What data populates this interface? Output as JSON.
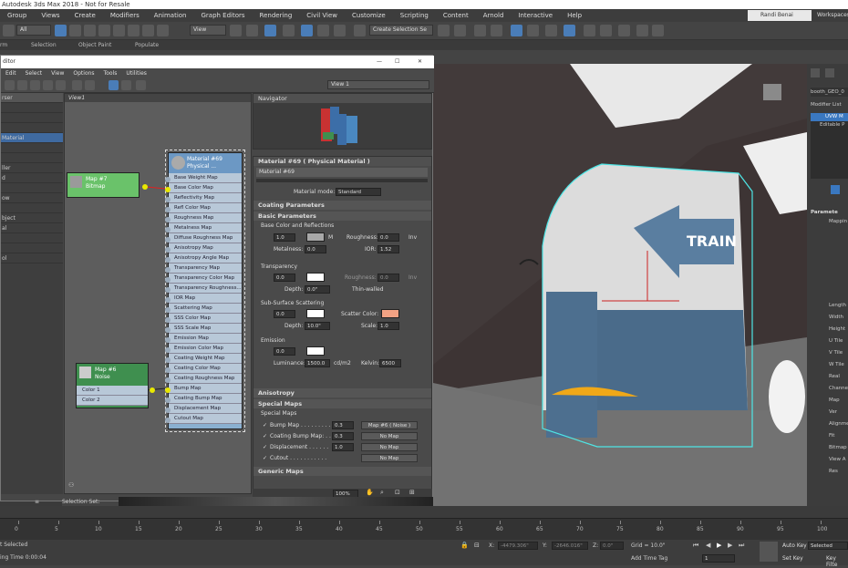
{
  "app": {
    "title": "Autodesk 3ds Max 2018 - Not for Resale"
  },
  "menu": [
    "Group",
    "Views",
    "Create",
    "Modifiers",
    "Animation",
    "Graph Editors",
    "Rendering",
    "Civil View",
    "Customize",
    "Scripting",
    "Content",
    "Arnold",
    "Interactive",
    "Help"
  ],
  "user": {
    "name": "Randi Benai",
    "workspaces_label": "Workspaces"
  },
  "toolbar": {
    "filter_value": "All",
    "view_value": "View",
    "selection_set_placeholder": "Create Selection Se"
  },
  "ribbon": {
    "items": [
      "rm",
      "Selection",
      "Object Paint",
      "Populate"
    ]
  },
  "sme": {
    "title": "ditor",
    "menu": [
      "Edit",
      "Select",
      "View",
      "Options",
      "Tools",
      "Utilities"
    ],
    "view_dropdown": "View 1",
    "browser_header": "rser",
    "browser_items": [
      "",
      "",
      "",
      "Material",
      "",
      "",
      "ller",
      "d",
      "",
      "ow",
      "",
      "bject",
      "al",
      "",
      "",
      "ol"
    ],
    "view_tab": "View1",
    "nodes": {
      "bitmap": {
        "title": "Map #7",
        "subtitle": "Bitmap"
      },
      "noise": {
        "title": "Map #6",
        "subtitle": "Noise",
        "slots": [
          "Color 1",
          "Color 2"
        ]
      },
      "material": {
        "title": "Material #69",
        "subtitle": "Physical ...",
        "slots": [
          "Base Weight Map",
          "Base Color Map",
          "Reflectivity Map",
          "Refl Color Map",
          "Roughness Map",
          "Metalness Map",
          "Diffuse Roughness Map",
          "Anisotropy Map",
          "Anisotropy Angle Map",
          "Transparency Map",
          "Transparency Color Map",
          "Transparency Roughness...",
          "IOR Map",
          "Scattering Map",
          "SSS Color Map",
          "SSS Scale Map",
          "Emission Map",
          "Emission Color Map",
          "Coating Weight Map",
          "Coating Color Map",
          "Coating Roughness Map",
          "Bump Map",
          "Coating Bump Map",
          "Displacement Map",
          "Cutout Map"
        ]
      }
    },
    "navigator_title": "Navigator",
    "zoom": "100%"
  },
  "params": {
    "header": "Material #69  ( Physical Material )",
    "name": "Material #69",
    "mode_label": "Material mode:",
    "mode_value": "Standard",
    "coating": "Coating Parameters",
    "basic": "Basic Parameters",
    "base_color_refl": "Base Color and Reflections",
    "base_weight": "1.0",
    "m_label": "M",
    "roughness_label": "Roughness:",
    "roughness_value": "0.0",
    "inv": "Inv",
    "metalness_label": "Metalness:",
    "metalness_value": "0.0",
    "ior_label": "IOR:",
    "ior_value": "1.52",
    "transparency": "Transparency",
    "trans_value": "0.0",
    "trans_rough_label": "Roughness:",
    "trans_rough_value": "0.0",
    "depth_label": "Depth:",
    "depth_value": "0.0\"",
    "thin_walled": "Thin-walled",
    "sss": "Sub-Surface Scattering",
    "sss_value": "0.0",
    "scatter_color_label": "Scatter Color:",
    "sss_depth_value": "10.0\"",
    "scale_label": "Scale:",
    "scale_value": "1.0",
    "emission": "Emission",
    "emission_value": "0.0",
    "luminance_label": "Luminance:",
    "luminance_value": "1500.0",
    "luminance_unit": "cd/m2",
    "kelvin_label": "Kelvin:",
    "kelvin_value": "6500",
    "anisotropy": "Anisotropy",
    "special_maps": "Special Maps",
    "special_maps_sub": "Special Maps",
    "maps": [
      {
        "label": "Bump Map . . . . . . . . .",
        "value": "0.3",
        "button": "Map #6  ( Noise )"
      },
      {
        "label": "Coating Bump Map: . . .",
        "value": "0.3",
        "button": "No Map"
      },
      {
        "label": "Displacement . . . . . .",
        "value": "1.0",
        "button": "No Map"
      },
      {
        "label": "Cutout . . . . . . . . . . .",
        "value": "",
        "button": "No Map"
      }
    ],
    "generic_maps": "Generic Maps",
    "colors": {
      "base": "#a8a8a8",
      "scatter": "#f2a283",
      "white": "#ffffff"
    }
  },
  "viewport": {
    "sign_text": "TRAIN"
  },
  "rightpanel": {
    "object_name": "booth_GEO_0",
    "modifier_list": "Modifier List",
    "stack": [
      "UVW M",
      "Editable P"
    ],
    "params_label": "Paramete",
    "mapping": "Mappin",
    "items": [
      "Length",
      "Width",
      "Height",
      "U Tile",
      "V Tile",
      "W Tile",
      "Real",
      "Channel",
      "Map",
      "Ver",
      "Alignme",
      "Fit",
      "Bitmap",
      "View A",
      "Res"
    ]
  },
  "timeline": {
    "ticks": [
      "0",
      "5",
      "10",
      "15",
      "20",
      "25",
      "30",
      "35",
      "40",
      "45",
      "50",
      "55",
      "60",
      "65",
      "70",
      "75",
      "80",
      "85",
      "90",
      "95",
      "100"
    ]
  },
  "status": {
    "selected": "t Selected",
    "time": "ing Time  0:00:04",
    "x_label": "X:",
    "x_value": "-4479.306\"",
    "y_label": "Y:",
    "y_value": "-2646.016\"",
    "z_label": "Z:",
    "z_value": "0.0\"",
    "grid": "Grid = 10.0\"",
    "add_time_tag": "Add Time Tag",
    "frame": "1",
    "auto_key": "Auto Key",
    "auto_key_mode": "Selected",
    "set_key": "Set Key",
    "key_filters": "Key Filte",
    "selection_set_label": "Selection Set:"
  }
}
